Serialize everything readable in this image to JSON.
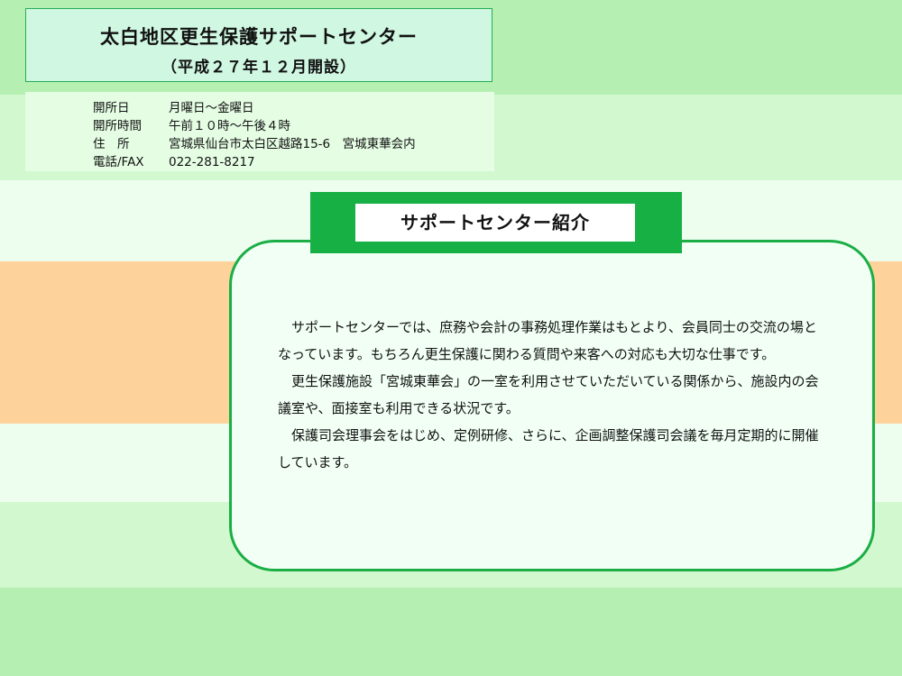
{
  "header": {
    "title": "太白地区更生保護サポートセンター",
    "subtitle": "（平成２７年１２月開設）"
  },
  "info": [
    {
      "label": "開所日",
      "value": "月曜日～金曜日"
    },
    {
      "label": "開所時間",
      "value": "午前１０時～午後４時"
    },
    {
      "label": "住　所",
      "value": "宮城県仙台市太白区越路15-6　宮城東華会内"
    },
    {
      "label": "電話/FAX",
      "value": "022-281-8217"
    }
  ],
  "section": {
    "heading": "サポートセンター紹介",
    "paragraphs": [
      "サポートセンターでは、庶務や会計の事務処理作業はもとより、会員同士の交流の場となっています。もちろん更生保護に関わる質問や来客への対応も大切な仕事です。",
      "更生保護施設「宮城東華会」の一室を利用させていただいている関係から、施設内の会議室や、面接室も利用できる状況です。",
      "保護司会理事会をはじめ、定例研修、さらに、企画調整保護司会議を毎月定期的に開催しています。"
    ]
  },
  "colors": {
    "band_green": "#b5f0b2",
    "band_light": "#d2f8cf",
    "band_orange": "#fdd39b",
    "accent_green": "#16b044"
  }
}
